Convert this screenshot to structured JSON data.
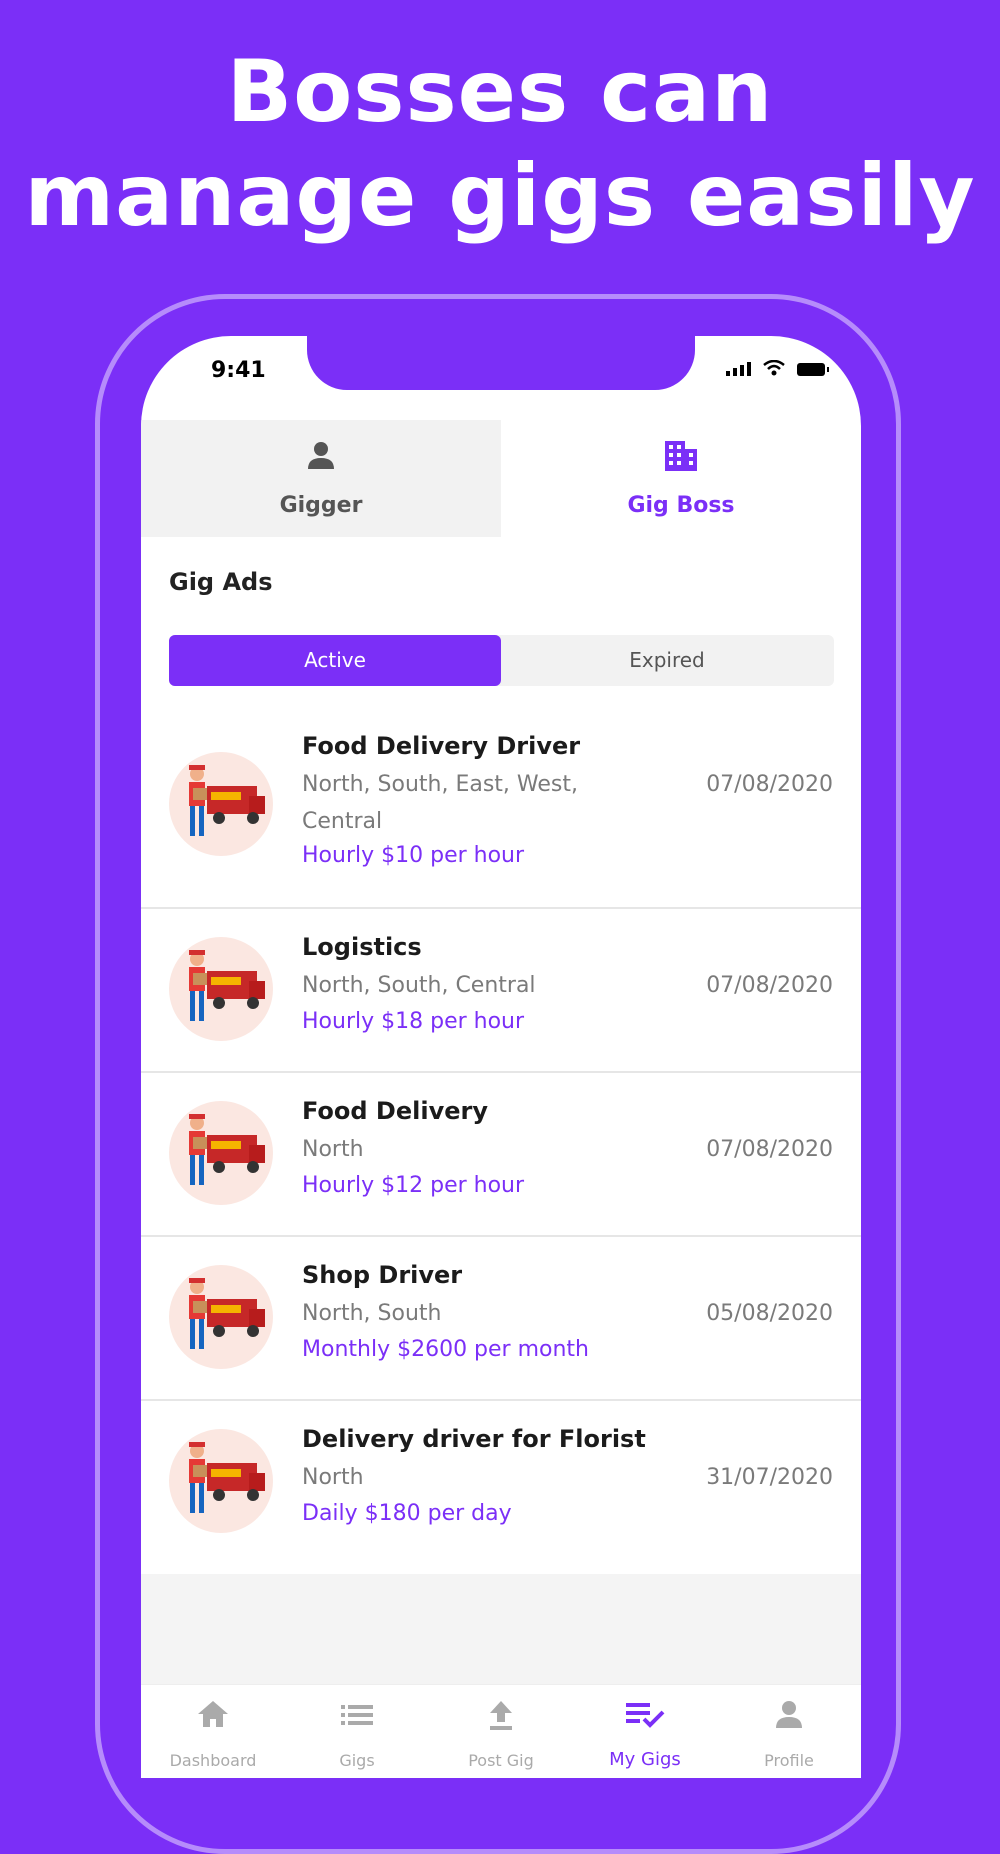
{
  "headline": {
    "line1": "Bosses can",
    "line2": "manage gigs easily"
  },
  "status_bar": {
    "time": "9:41"
  },
  "role_tabs": [
    {
      "label": "Gigger",
      "icon": "person-icon",
      "selected": false
    },
    {
      "label": "Gig Boss",
      "icon": "building-icon",
      "selected": true
    }
  ],
  "section_title": "Gig Ads",
  "segments": {
    "active": "Active",
    "expired": "Expired",
    "selected": "Active"
  },
  "gigs": [
    {
      "title": "Food Delivery Driver",
      "locations": "North, South, East, West, Central",
      "pay": "Hourly $10 per hour",
      "date": "07/08/2020"
    },
    {
      "title": "Logistics",
      "locations": "North, South, Central",
      "pay": "Hourly $18 per hour",
      "date": "07/08/2020"
    },
    {
      "title": "Food Delivery",
      "locations": "North",
      "pay": "Hourly $12 per hour",
      "date": "07/08/2020"
    },
    {
      "title": "Shop Driver",
      "locations": "North, South",
      "pay": "Monthly $2600 per month",
      "date": "05/08/2020"
    },
    {
      "title": "Delivery driver for Florist",
      "locations": "North",
      "pay": "Daily $180 per day",
      "date": "31/07/2020"
    }
  ],
  "bottom_nav": [
    {
      "label": "Dashboard",
      "icon": "home-icon"
    },
    {
      "label": "Gigs",
      "icon": "list-icon"
    },
    {
      "label": "Post Gig",
      "icon": "upload-icon"
    },
    {
      "label": "My Gigs",
      "icon": "checklist-icon",
      "active": true
    },
    {
      "label": "Profile",
      "icon": "profile-icon"
    }
  ],
  "colors": {
    "brand": "#7b2ff7",
    "muted": "#7a7a7a",
    "divider": "#e6e6e6"
  }
}
